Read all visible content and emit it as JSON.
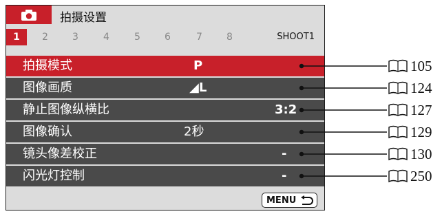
{
  "menu": {
    "title": "拍摄设置",
    "tabs": [
      "1",
      "2",
      "3",
      "4",
      "5",
      "6",
      "7",
      "8"
    ],
    "tab_label": "SHOOT1",
    "items": [
      {
        "label": "拍摄模式",
        "value": "P"
      },
      {
        "label": "图像画质",
        "value": "◢L"
      },
      {
        "label": "静止图像纵横比",
        "value": "3:2"
      },
      {
        "label": "图像确认",
        "value": "2秒"
      },
      {
        "label": "镜头像差校正",
        "value": "-"
      },
      {
        "label": "闪光灯控制",
        "value": "-"
      }
    ],
    "footer_button": "MENU"
  },
  "refs": [
    "105",
    "124",
    "127",
    "129",
    "130",
    "250"
  ],
  "colors": {
    "accent": "#c8202a",
    "row_dark": "#4a4a4a",
    "panel": "#dcdcdc"
  }
}
